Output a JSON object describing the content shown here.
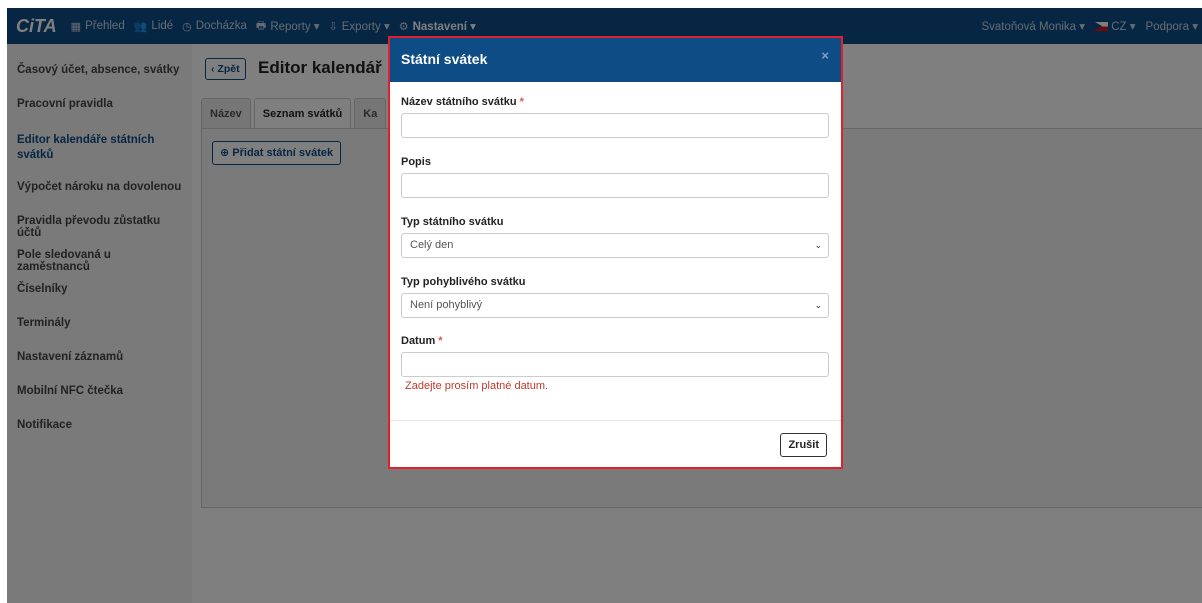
{
  "app": {
    "logo": "CiTA",
    "nav": [
      {
        "icon": "grid-icon",
        "glyph": "▦",
        "label": "Přehled"
      },
      {
        "icon": "people-icon",
        "glyph": "👥",
        "label": "Lidé"
      },
      {
        "icon": "clock-icon",
        "glyph": "◷",
        "label": "Docházka"
      },
      {
        "icon": "printer-icon",
        "glyph": "🖶",
        "label": "Reporty ▾"
      },
      {
        "icon": "export-icon",
        "glyph": "⇩",
        "label": "Exporty ▾"
      },
      {
        "icon": "gear-icon",
        "glyph": "⚙",
        "label": "Nastavení ▾"
      }
    ],
    "user": "Svatoňová Monika ▾",
    "language": "CZ ▾",
    "support": "Podpora ▾"
  },
  "sidebar": {
    "items": [
      {
        "label": "Časový účet, absence, svátky"
      },
      {
        "label": "Pracovní pravidla"
      },
      {
        "label": "Editor kalendáře státních svátků"
      },
      {
        "label": "Výpočet nároku na dovolenou"
      },
      {
        "label": "Pravidla převodu zůstatku účtů"
      },
      {
        "label": "Pole sledovaná u zaměstnanců"
      },
      {
        "label": "Číselníky"
      },
      {
        "label": "Terminály"
      },
      {
        "label": "Nastavení záznamů"
      },
      {
        "label": "Mobilní NFC čtečka"
      },
      {
        "label": "Notifikace"
      }
    ]
  },
  "page": {
    "back": "‹ Zpět",
    "title": "Editor kalendář",
    "tabs": [
      {
        "label": "Název"
      },
      {
        "label": "Seznam svátků"
      },
      {
        "label": "Ka"
      }
    ],
    "add_button": "Přidat státní svátek",
    "collapse_glyph": "‹"
  },
  "modal": {
    "title": "Státní svátek",
    "close": "×",
    "name_label": "Název státního svátku",
    "name_value": "",
    "description_label": "Popis",
    "description_value": "",
    "type_label": "Typ státního svátku",
    "type_value": "Celý den",
    "movable_label": "Typ pohyblivého svátku",
    "movable_value": "Není pohyblivý",
    "date_label": "Datum",
    "date_value": "",
    "date_error": "Zadejte prosím platné datum.",
    "required_marker": "*",
    "cancel": "Zrušit"
  }
}
